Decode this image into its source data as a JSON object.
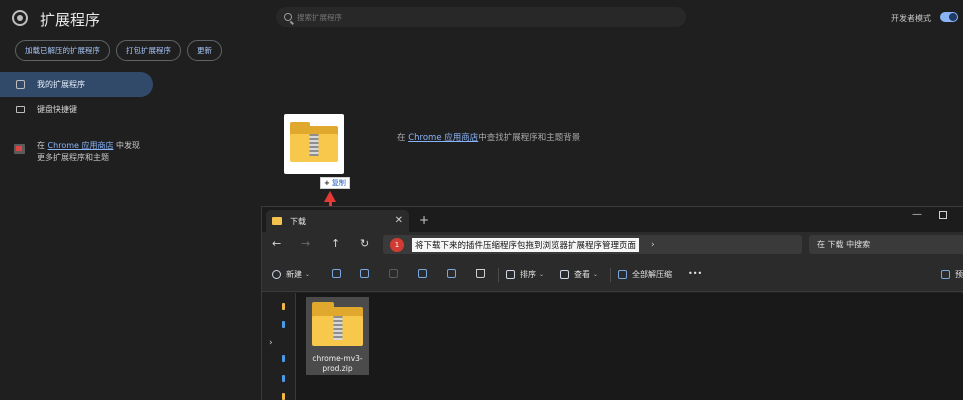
{
  "app": {
    "title": "扩展程序"
  },
  "search": {
    "placeholder": "搜索扩展程序"
  },
  "developer_mode": {
    "label": "开发者模式",
    "on": true
  },
  "actions": {
    "load_unpacked": "加载已解压的扩展程序",
    "pack": "打包扩展程序",
    "update": "更新"
  },
  "sidebar": {
    "items": [
      {
        "label": "我的扩展程序",
        "active": true
      },
      {
        "label": "键盘快捷键",
        "active": false
      }
    ],
    "store_prefix": "在 ",
    "store_link": "Chrome 应用商店",
    "store_suffix": " 中发现",
    "store_line2": "更多扩展程序和主题"
  },
  "main": {
    "prefix": "在 ",
    "link": "Chrome 应用商店",
    "suffix": "中查找扩展程序和主题背景"
  },
  "drag": {
    "copy_label": "复制"
  },
  "explorer": {
    "tab_label": "下载",
    "step_number": "1",
    "instruction": "将下载下来的插件压缩程序包拖到浏览器扩展程序管理页面",
    "search_placeholder": "在 下载 中搜索",
    "toolbar": {
      "new": "新建",
      "sort": "排序",
      "view": "查看",
      "extract_all": "全部解压缩",
      "more": "•••",
      "preview": "预"
    },
    "file": {
      "name": "chrome-mv3-prod.zip"
    }
  },
  "colors": {
    "accent": "#8ab4f8",
    "active_bg": "#324a6a",
    "arrow": "#e53935",
    "folder": "#f7c84b",
    "badge": "#d23b31"
  }
}
